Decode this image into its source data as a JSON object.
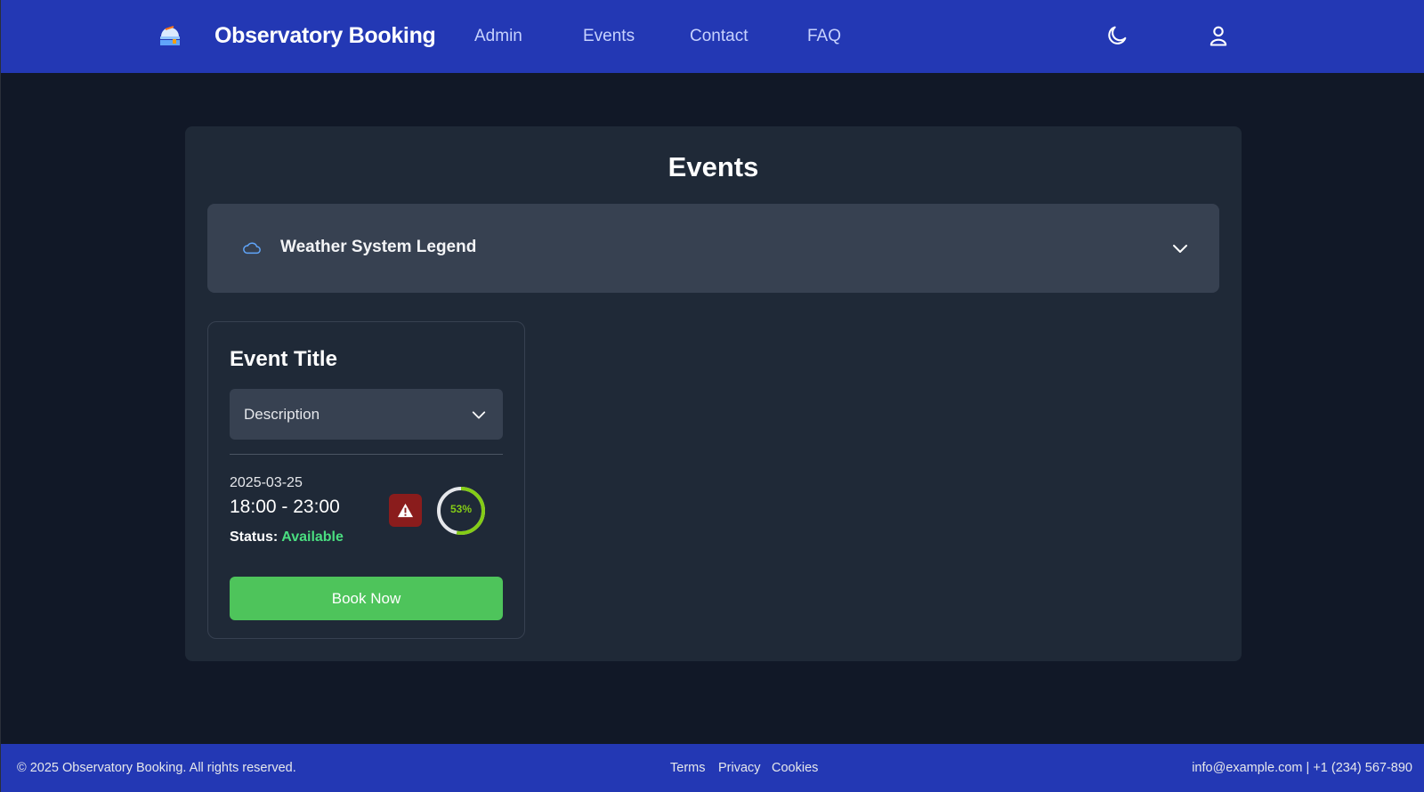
{
  "header": {
    "brand": "Observatory Booking",
    "logo_icon": "observatory-icon",
    "nav": [
      "Admin",
      "Events",
      "Contact",
      "FAQ"
    ],
    "theme_icon": "moon-icon",
    "user_icon": "user-icon"
  },
  "main": {
    "title": "Events",
    "legend": {
      "label": "Weather System Legend",
      "icon": "cloud-icon"
    },
    "event": {
      "title": "Event Title",
      "description_label": "Description",
      "date": "2025-03-25",
      "time": "18:00 - 23:00",
      "status_label": "Status:",
      "status_value": "Available",
      "weather_icon": "warning-icon",
      "gauge_percent": 53,
      "gauge_text": "53%",
      "book_label": "Book Now"
    }
  },
  "footer": {
    "copyright": "© 2025 Observatory Booking. All rights reserved.",
    "links": [
      "Terms",
      "Privacy",
      "Cookies"
    ],
    "contact": "info@example.com | +1 (234) 567-890"
  },
  "colors": {
    "header_bg": "#2338b4",
    "page_bg": "#111827",
    "panel_bg": "#1f2937",
    "accent_green": "#4ec45b",
    "status_green": "#4ade80",
    "warning_red": "#8a1c1c",
    "gauge_green": "#84cc16"
  }
}
